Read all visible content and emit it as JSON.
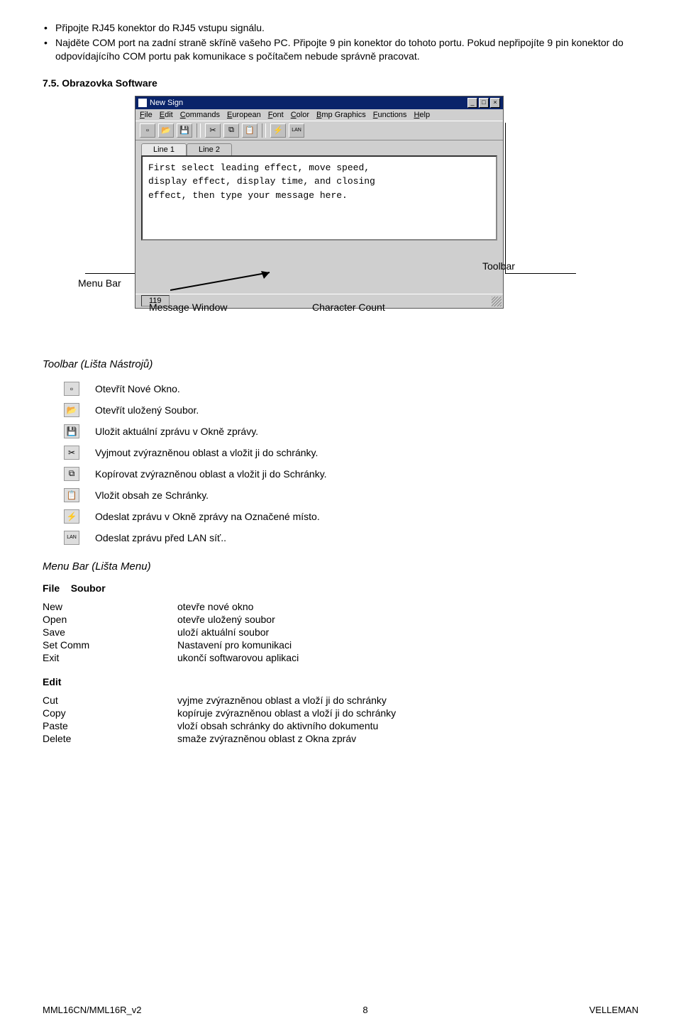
{
  "intro_bullets": [
    "Připojte RJ45 konektor do RJ45 vstupu signálu.",
    "Najděte COM port na zadní straně skříně vašeho PC. Připojte 9 pin konektor do tohoto portu. Pokud nepřipojíte 9 pin konektor do odpovídajícího COM portu pak komunikace s počítačem nebude správně pracovat."
  ],
  "section_heading": "7.5.  Obrazovka Software",
  "app_window": {
    "title": "New Sign",
    "menu": [
      "File",
      "Edit",
      "Commands",
      "European",
      "Font",
      "Color",
      "Bmp Graphics",
      "Functions",
      "Help"
    ],
    "tabs": [
      "Line 1",
      "Line 2"
    ],
    "editor_text": "First select leading effect, move speed,\ndisplay effect, display time, and closing\neffect, then type your message here.",
    "status": "119"
  },
  "callouts": {
    "menu_bar": "Menu Bar",
    "toolbar": "Toolbar",
    "message_window": "Message Window",
    "character_count": "Character Count"
  },
  "toolbar_section_title": "Toolbar (Lišta Nástrojů)",
  "toolbar_items": [
    {
      "name": "new-icon",
      "label": "Otevřít Nové Okno."
    },
    {
      "name": "open-icon",
      "label": "Otevřít uložený Soubor."
    },
    {
      "name": "save-icon",
      "label": "Uložit aktuální zprávu v Okně zprávy."
    },
    {
      "name": "cut-icon",
      "label": "Vyjmout zvýrazněnou oblast a vložit ji do schránky."
    },
    {
      "name": "copy-icon",
      "label": "Kopírovat zvýrazněnou oblast a vložit ji do Schránky."
    },
    {
      "name": "paste-icon",
      "label": "Vložit obsah ze Schránky."
    },
    {
      "name": "send-icon",
      "label": "Odeslat zprávu v Okně zprávy na Označené místo."
    },
    {
      "name": "send-lan-icon",
      "label": "Odeslat zprávu před LAN síť.."
    }
  ],
  "menu_section_title": "Menu Bar (Lišta Menu)",
  "file_heading_bold": "File",
  "file_heading_rest": "Soubor",
  "file_cmds": [
    {
      "n": "New",
      "d": "otevře nové okno"
    },
    {
      "n": "Open",
      "d": "otevře uložený soubor"
    },
    {
      "n": "Save",
      "d": "uloží aktuální soubor"
    },
    {
      "n": "Set Comm",
      "d": "Nastavení pro komunikaci"
    },
    {
      "n": "Exit",
      "d": "ukončí softwarovou aplikaci"
    }
  ],
  "edit_heading": "Edit",
  "edit_cmds": [
    {
      "n": "Cut",
      "d": "vyjme zvýrazněnou oblast a vloží ji do schránky"
    },
    {
      "n": "Copy",
      "d": "kopíruje zvýrazněnou oblast a vloží ji do schránky"
    },
    {
      "n": "Paste",
      "d": "vloží obsah schránky do aktivního dokumentu"
    },
    {
      "n": "Delete",
      "d": "smaže zvýrazněnou oblast z Okna zpráv"
    }
  ],
  "footer": {
    "left": "MML16CN/MML16R_v2",
    "center": "8",
    "right": "VELLEMAN"
  }
}
